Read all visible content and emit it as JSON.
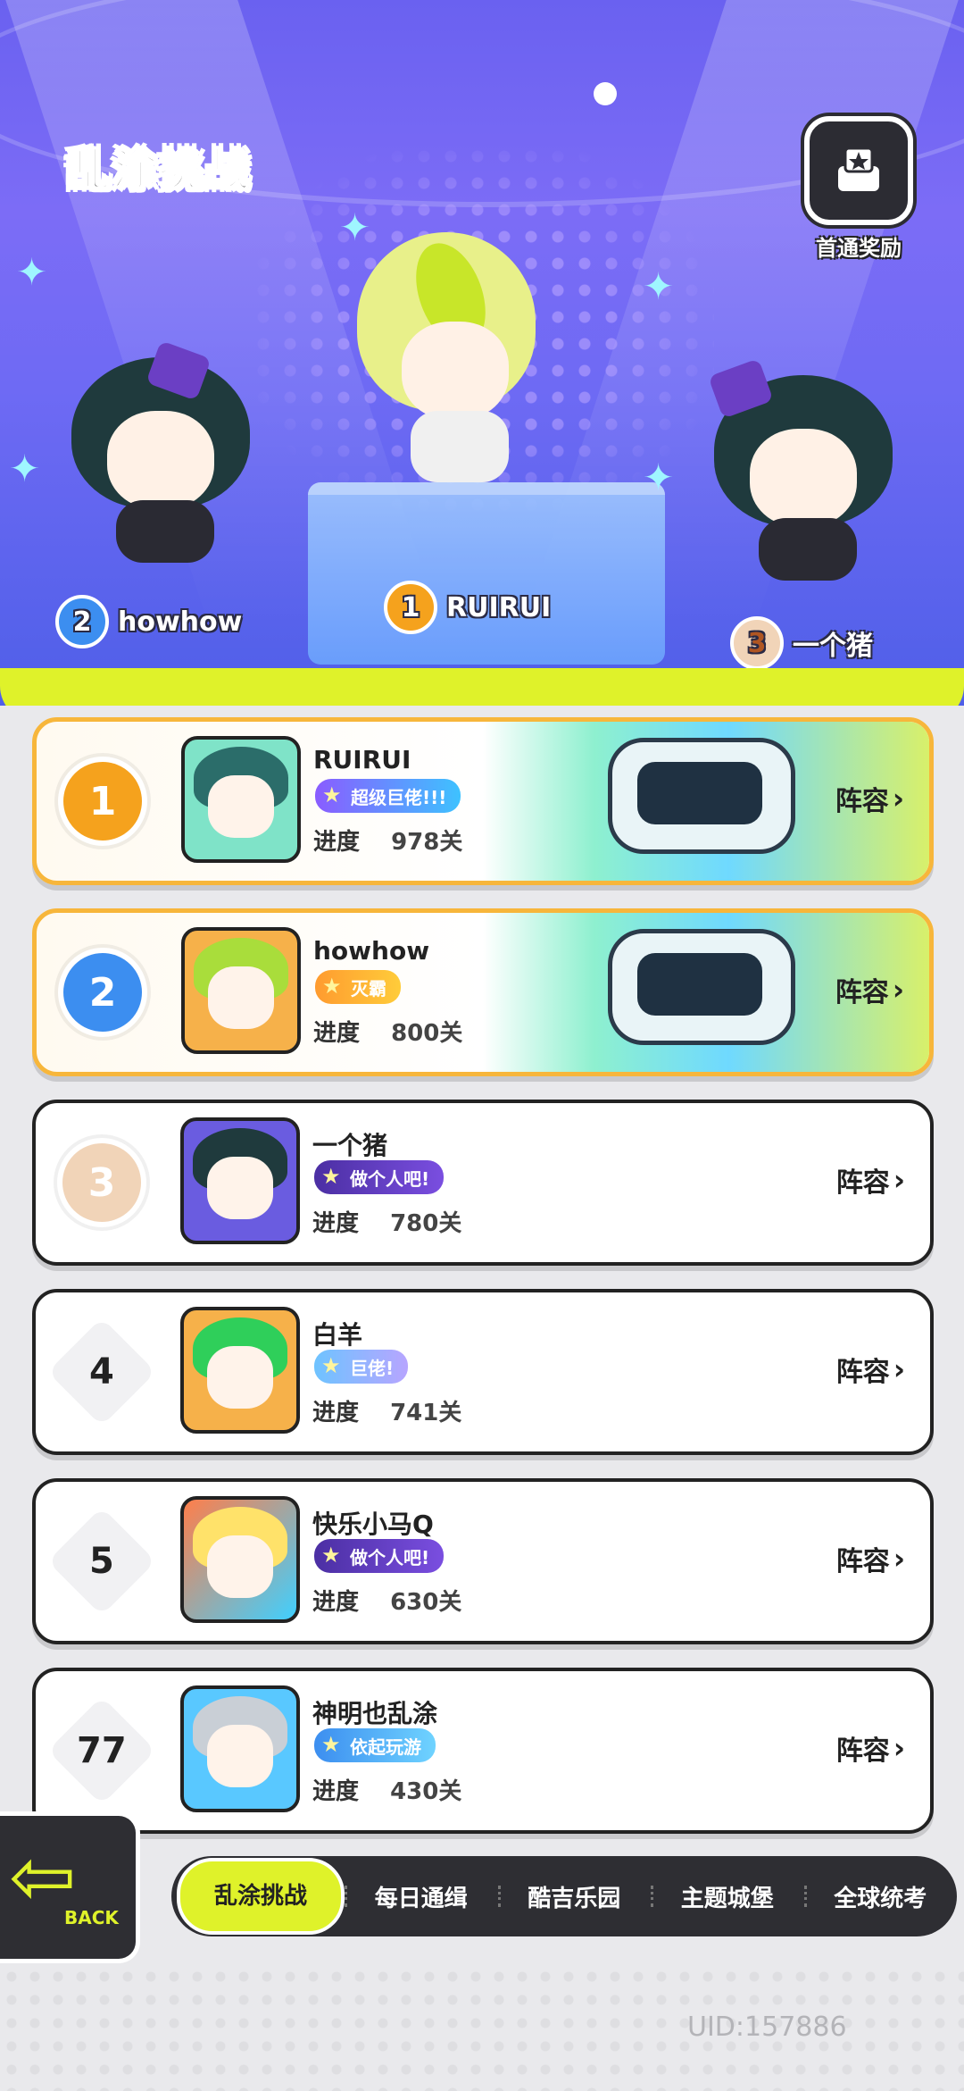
{
  "header": {
    "title": "乱涂挑战",
    "reward_label": "首通奖励"
  },
  "podium": [
    {
      "rank": "2",
      "name": "howhow"
    },
    {
      "rank": "1",
      "name": "RUIRUI"
    },
    {
      "rank": "3",
      "name": "一个猪"
    }
  ],
  "leaderboard": {
    "progress_label": "进度",
    "lineup_label": "阵容",
    "rows": [
      {
        "rank": "1",
        "name": "RUIRUI",
        "badge": "超级巨佬!!!",
        "progress": "978关"
      },
      {
        "rank": "2",
        "name": "howhow",
        "badge": "灭霸",
        "progress": "800关"
      },
      {
        "rank": "3",
        "name": "一个猪",
        "badge": "做个人吧!",
        "progress": "780关"
      },
      {
        "rank": "4",
        "name": "白羊",
        "badge": "巨佬!",
        "progress": "741关"
      },
      {
        "rank": "5",
        "name": "快乐小马Q",
        "badge": "做个人吧!",
        "progress": "630关"
      },
      {
        "rank": "77",
        "name": "神明也乱涂",
        "badge": "依起玩游",
        "progress": "430关"
      }
    ]
  },
  "nav": {
    "back_label": "BACK",
    "tabs": [
      "乱涂挑战",
      "每日通缉",
      "酷吉乐园",
      "主题城堡",
      "全球统考"
    ],
    "active_tab": "乱涂挑战"
  },
  "footer": {
    "uid": "UID:157886"
  },
  "colors": {
    "accent_lime": "#dff22a",
    "gold_border": "#f7b63b",
    "hero_purple": "#6a61f0"
  }
}
